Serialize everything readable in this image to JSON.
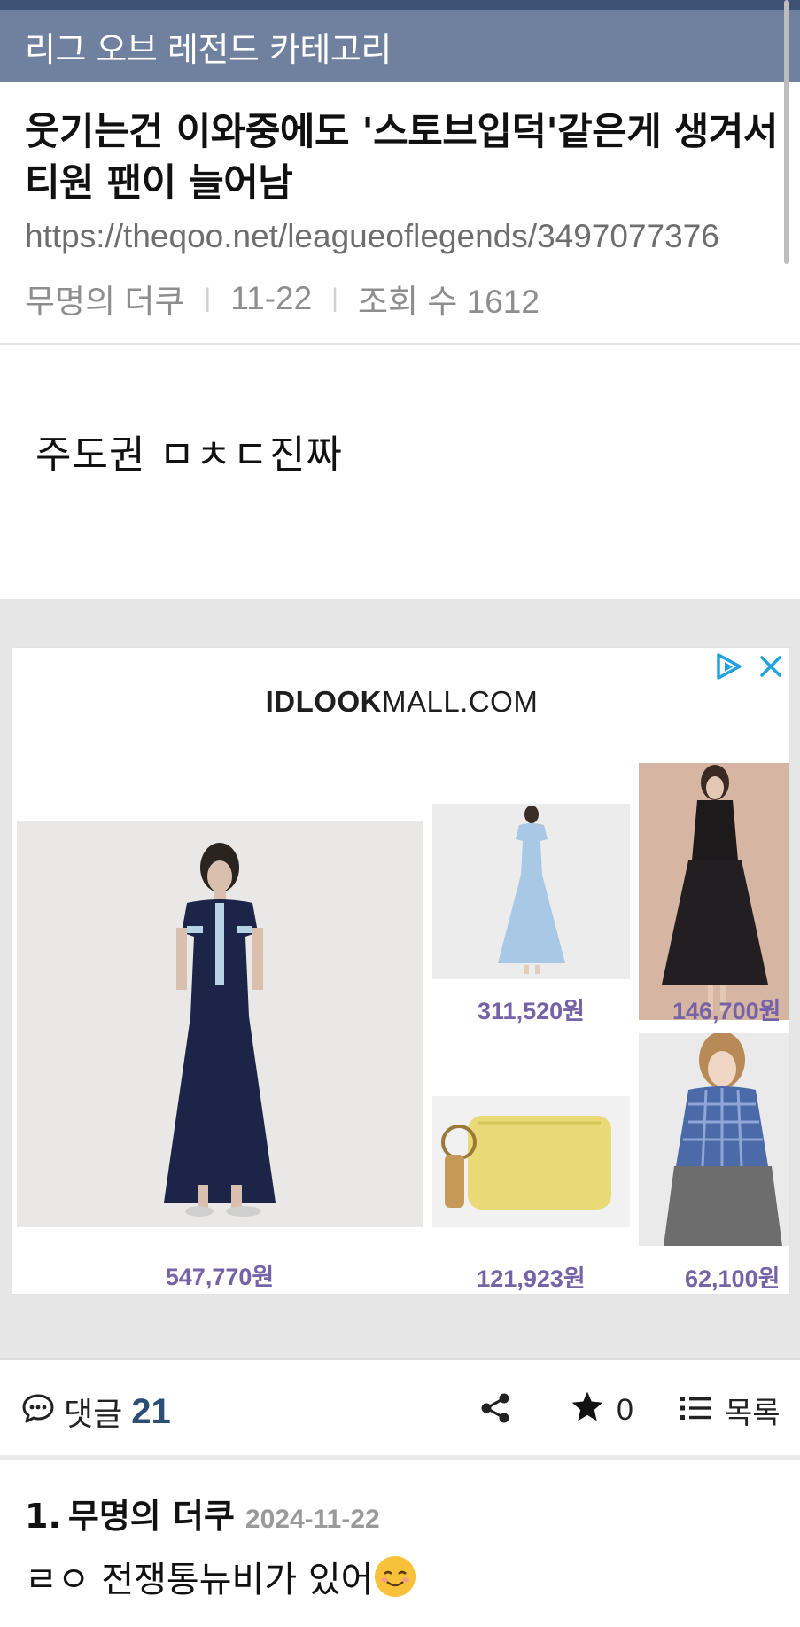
{
  "header": {
    "category_title": "리그 오브 레전드 카테고리"
  },
  "post": {
    "title": "웃기는건 이와중에도 '스토브입덕'같은게 생겨서 티원 팬이 늘어남",
    "url": "https://theqoo.net/leagueoflegends/3497077376",
    "author": "무명의 더쿠",
    "date": "11-22",
    "views_label": "조회 수 1612",
    "body": "주도권 ㅁㅊㄷ진짜"
  },
  "ad": {
    "brand_bold": "IDLOOK",
    "brand_rest": "MALL.COM",
    "icons": [
      "adchoices-icon",
      "close-icon"
    ],
    "products": [
      {
        "name": "navy-knit-dress",
        "price": "547,770원"
      },
      {
        "name": "light-blue-shirt-dress",
        "price": "311,520원"
      },
      {
        "name": "black-lace-skirt-outfit",
        "price": "146,700원"
      },
      {
        "name": "yellow-coin-wallet",
        "price": "121,923원"
      },
      {
        "name": "blue-check-shirt-outfit",
        "price": "62,100원"
      }
    ]
  },
  "actions": {
    "comments_label": "댓글",
    "comments_count": "21",
    "star_count": "0",
    "list_label": "목록",
    "icons": [
      "comment-icon",
      "share-icon",
      "star-icon",
      "list-icon"
    ]
  },
  "comments": [
    {
      "index": "1.",
      "author": "무명의 더쿠",
      "date": "2024-11-22",
      "text": "ㄹㅇ 전쟁통뉴비가 있어"
    }
  ],
  "colors": {
    "category_bar": "#6f819e",
    "top_line": "#3e5276",
    "price": "#7463a6",
    "comment_count": "#2b4f74",
    "adchoices": "#20a3df"
  }
}
